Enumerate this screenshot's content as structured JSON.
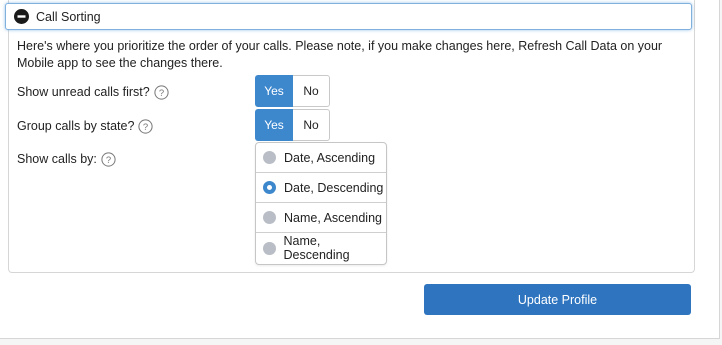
{
  "section": {
    "title": "Call Sorting",
    "collapse_icon": "minus-circle-icon"
  },
  "intro": "Here's where you prioritize the order of your calls. Please note, if you make changes here, Refresh Call Data on your Mobile app to see the changes there.",
  "settings": {
    "unread_first": {
      "label": "Show unread calls first?",
      "help_icon": "question-circle-icon",
      "options": [
        "Yes",
        "No"
      ],
      "selected": "Yes"
    },
    "group_by_state": {
      "label": "Group calls by state?",
      "help_icon": "question-circle-icon",
      "options": [
        "Yes",
        "No"
      ],
      "selected": "Yes"
    },
    "show_by": {
      "label": "Show calls by:",
      "help_icon": "question-circle-icon",
      "options": [
        "Date, Ascending",
        "Date, Descending",
        "Name, Ascending",
        "Name, Descending"
      ],
      "selected": "Date, Descending"
    }
  },
  "update_button": "Update Profile",
  "colors": {
    "accent": "#3d87cd",
    "button": "#2e74bf",
    "header_glow": "#7fb0de"
  }
}
